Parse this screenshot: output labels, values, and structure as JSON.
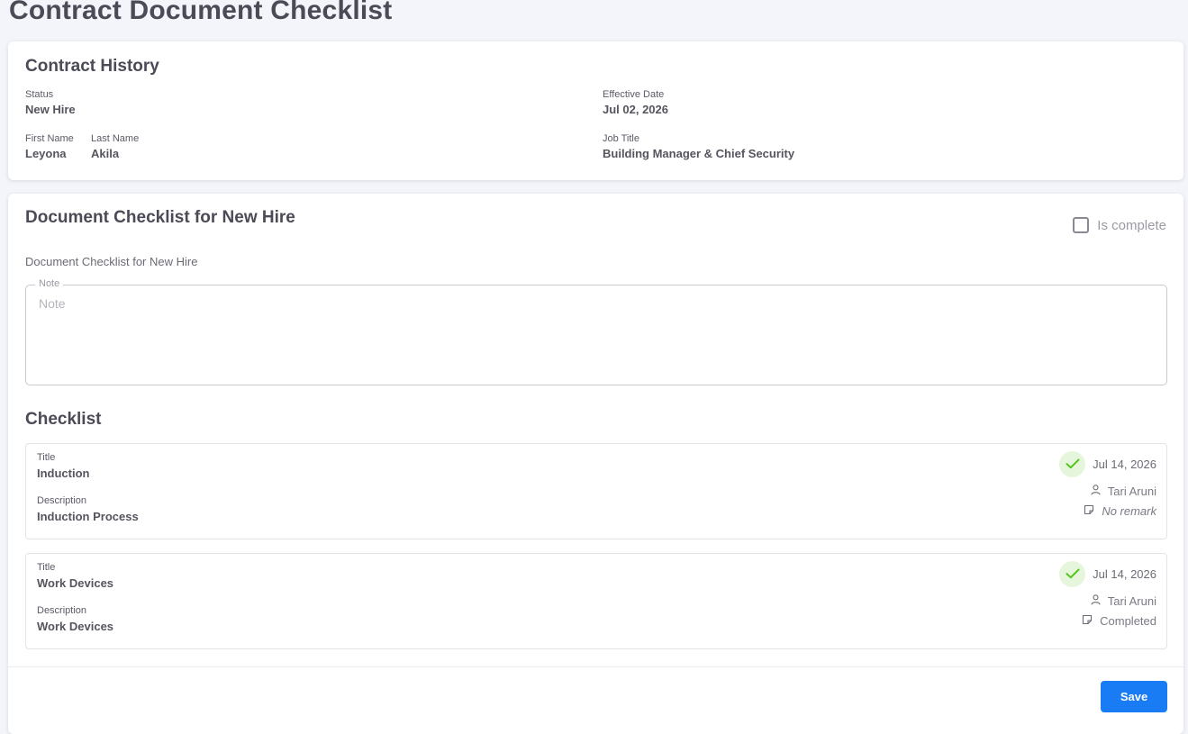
{
  "page": {
    "title": "Contract Document Checklist"
  },
  "contract_history": {
    "title": "Contract History",
    "status_label": "Status",
    "status_value": "New Hire",
    "effective_date_label": "Effective Date",
    "effective_date_value": "Jul 02, 2026",
    "first_name_label": "First Name",
    "first_name_value": "Leyona",
    "last_name_label": "Last Name",
    "last_name_value": "Akila",
    "job_title_label": "Job Title",
    "job_title_value": "Building Manager & Chief Security"
  },
  "checklist_card": {
    "title": "Document Checklist for New Hire",
    "is_complete_label": "Is complete",
    "is_complete_checked": false,
    "subtitle": "Document Checklist for New Hire",
    "note_legend": "Note",
    "note_placeholder": "Note",
    "note_value": "",
    "section_title": "Checklist",
    "items": [
      {
        "title_label": "Title",
        "title_value": "Induction",
        "description_label": "Description",
        "description_value": "Induction Process",
        "date": "Jul 14, 2026",
        "user": "Tari Aruni",
        "remark": "No remark",
        "status_icon": "check-icon"
      },
      {
        "title_label": "Title",
        "title_value": "Work Devices",
        "description_label": "Description",
        "description_value": "Work Devices",
        "date": "Jul 14, 2026",
        "user": "Tari Aruni",
        "remark": "Completed",
        "status_icon": "check-icon"
      }
    ],
    "save_label": "Save"
  },
  "colors": {
    "accent": "#1a7cf5",
    "check_green": "#52c41a",
    "check_bg": "#e6f6dc",
    "background": "#f4f5fa"
  }
}
